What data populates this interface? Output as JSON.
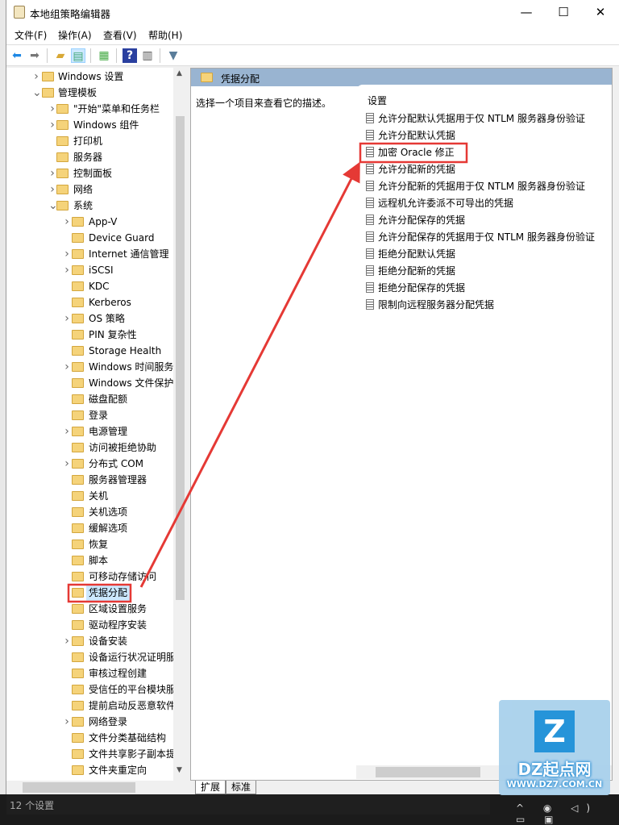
{
  "window": {
    "title": "本地组策略编辑器",
    "minimize": "—",
    "maximize": "☐",
    "close": "✕"
  },
  "menu": [
    "文件(F)",
    "操作(A)",
    "查看(V)",
    "帮助(H)"
  ],
  "toolbar": [
    "back-icon",
    "forward-icon",
    "up-folder-icon",
    "show-hide-tree-icon",
    "export-list-icon",
    "help-icon",
    "show-hide-action-pane-icon",
    "filter-icon"
  ],
  "tree": [
    {
      "l": 0,
      "e": ">",
      "t": "Windows 设置"
    },
    {
      "l": 0,
      "e": "v",
      "t": "管理模板"
    },
    {
      "l": 1,
      "e": ">",
      "t": "\"开始\"菜单和任务栏"
    },
    {
      "l": 1,
      "e": ">",
      "t": "Windows 组件"
    },
    {
      "l": 1,
      "e": "",
      "t": "打印机"
    },
    {
      "l": 1,
      "e": "",
      "t": "服务器"
    },
    {
      "l": 1,
      "e": ">",
      "t": "控制面板"
    },
    {
      "l": 1,
      "e": ">",
      "t": "网络"
    },
    {
      "l": 1,
      "e": "v",
      "t": "系统"
    },
    {
      "l": 2,
      "e": ">",
      "t": "App-V"
    },
    {
      "l": 2,
      "e": "",
      "t": "Device Guard"
    },
    {
      "l": 2,
      "e": ">",
      "t": "Internet 通信管理"
    },
    {
      "l": 2,
      "e": ">",
      "t": "iSCSI"
    },
    {
      "l": 2,
      "e": "",
      "t": "KDC"
    },
    {
      "l": 2,
      "e": "",
      "t": "Kerberos"
    },
    {
      "l": 2,
      "e": ">",
      "t": "OS 策略"
    },
    {
      "l": 2,
      "e": "",
      "t": "PIN 复杂性"
    },
    {
      "l": 2,
      "e": "",
      "t": "Storage Health"
    },
    {
      "l": 2,
      "e": ">",
      "t": "Windows 时间服务"
    },
    {
      "l": 2,
      "e": "",
      "t": "Windows 文件保护"
    },
    {
      "l": 2,
      "e": "",
      "t": "磁盘配额"
    },
    {
      "l": 2,
      "e": "",
      "t": "登录"
    },
    {
      "l": 2,
      "e": ">",
      "t": "电源管理"
    },
    {
      "l": 2,
      "e": "",
      "t": "访问被拒绝协助"
    },
    {
      "l": 2,
      "e": ">",
      "t": "分布式 COM"
    },
    {
      "l": 2,
      "e": "",
      "t": "服务器管理器"
    },
    {
      "l": 2,
      "e": "",
      "t": "关机"
    },
    {
      "l": 2,
      "e": "",
      "t": "关机选项"
    },
    {
      "l": 2,
      "e": "",
      "t": "缓解选项"
    },
    {
      "l": 2,
      "e": "",
      "t": "恢复"
    },
    {
      "l": 2,
      "e": "",
      "t": "脚本"
    },
    {
      "l": 2,
      "e": "",
      "t": "可移动存储访问"
    },
    {
      "l": 2,
      "e": "",
      "t": "凭据分配",
      "selected": true
    },
    {
      "l": 2,
      "e": "",
      "t": "区域设置服务"
    },
    {
      "l": 2,
      "e": "",
      "t": "驱动程序安装"
    },
    {
      "l": 2,
      "e": ">",
      "t": "设备安装"
    },
    {
      "l": 2,
      "e": "",
      "t": "设备运行状况证明服"
    },
    {
      "l": 2,
      "e": "",
      "t": "审核过程创建"
    },
    {
      "l": 2,
      "e": "",
      "t": "受信任的平台模块服"
    },
    {
      "l": 2,
      "e": "",
      "t": "提前启动反恶意软件"
    },
    {
      "l": 2,
      "e": ">",
      "t": "网络登录"
    },
    {
      "l": 2,
      "e": "",
      "t": "文件分类基础结构"
    },
    {
      "l": 2,
      "e": "",
      "t": "文件共享影子副本提"
    },
    {
      "l": 2,
      "e": "",
      "t": "文件夹重定向"
    }
  ],
  "right": {
    "header": "凭据分配",
    "description": "选择一个项目来查看它的描述。",
    "column": "设置",
    "items": [
      "允许分配默认凭据用于仅 NTLM 服务器身份验证",
      "允许分配默认凭据",
      "加密 Oracle 修正",
      "允许分配新的凭据",
      "允许分配新的凭据用于仅 NTLM 服务器身份验证",
      "远程机允许委派不可导出的凭据",
      "允许分配保存的凭据",
      "允许分配保存的凭据用于仅 NTLM 服务器身份验证",
      "拒绝分配默认凭据",
      "拒绝分配新的凭据",
      "拒绝分配保存的凭据",
      "限制向远程服务器分配凭据"
    ],
    "highlighted": "加密 Oracle 修正"
  },
  "tabs": [
    "扩展",
    "标准"
  ],
  "status": "12 个设置",
  "watermark": {
    "logo": "LZ",
    "name": "DZ起点网",
    "url": "WWW.DZ7.COM.CN"
  },
  "colors": {
    "highlight_box": "#e53935",
    "header": "#99b4d1",
    "selected": "#cce8ff"
  }
}
